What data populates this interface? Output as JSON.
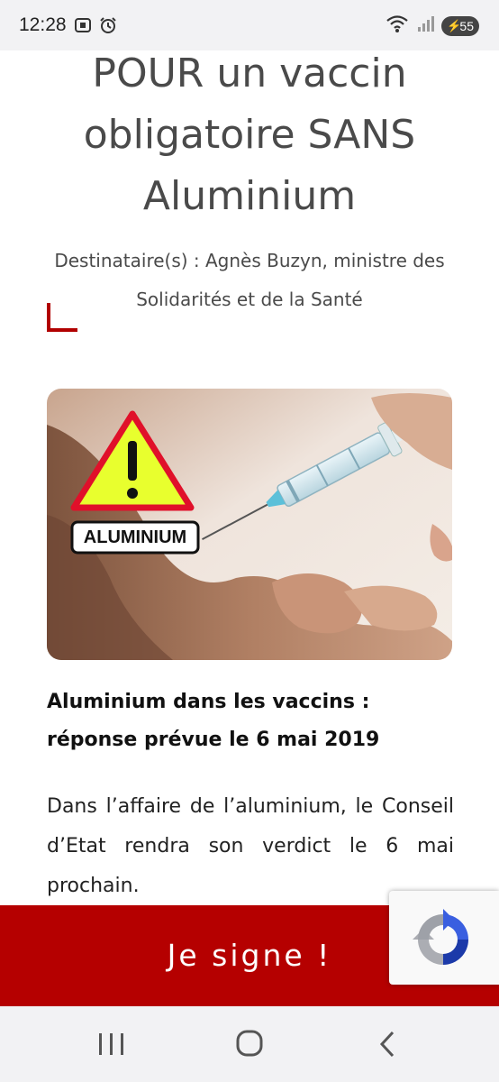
{
  "status_bar": {
    "time": "12:28",
    "battery_level": "55",
    "left_icons": [
      "screenshot-icon",
      "alarm-icon"
    ],
    "right_icons": [
      "wifi-icon",
      "signal-icon",
      "battery-icon"
    ]
  },
  "petition": {
    "title": "POUR un vaccin obligatoire SANS Aluminium",
    "recipient": "Destinataire(s) : Agnès Buzyn, ministre des Solidarités et de la Santé",
    "accent_color": "#b10000"
  },
  "hero_image": {
    "warning_label": "ALUMINIUM"
  },
  "article": {
    "heading": "Aluminium dans les vaccins : réponse prévue le 6 mai 2019",
    "body": "Dans l’affaire de l’aluminium, le Conseil d’Etat rendra son verdict le 6 mai prochain."
  },
  "sign_button": {
    "label": "Je signe !",
    "color": "#b50000"
  },
  "recaptcha": {
    "icon": "recaptcha-icon"
  },
  "nav_bar": {
    "buttons": [
      "recent-apps-icon",
      "home-icon",
      "back-icon"
    ]
  }
}
